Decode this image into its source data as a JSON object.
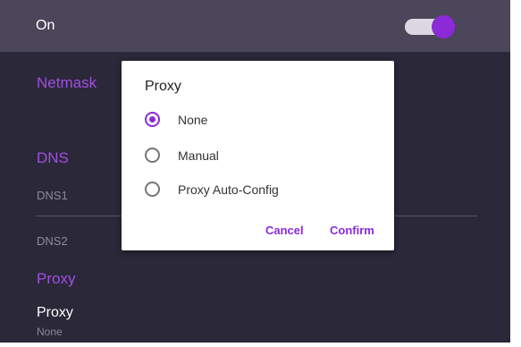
{
  "header": {
    "label": "On",
    "toggle_on": true
  },
  "sections": {
    "netmask_title": "Netmask",
    "dns_title": "DNS",
    "dns1_label": "DNS1",
    "dns2_label": "DNS2",
    "proxy_title": "Proxy"
  },
  "proxy_setting": {
    "title": "Proxy",
    "value": "None"
  },
  "dialog": {
    "title": "Proxy",
    "options": [
      {
        "label": "None",
        "selected": true
      },
      {
        "label": "Manual",
        "selected": false
      },
      {
        "label": "Proxy Auto-Config",
        "selected": false
      }
    ],
    "cancel_label": "Cancel",
    "confirm_label": "Confirm"
  },
  "colors": {
    "accent": "#8b2ad6",
    "background": "#2b2839",
    "header_background": "#4b4659"
  }
}
